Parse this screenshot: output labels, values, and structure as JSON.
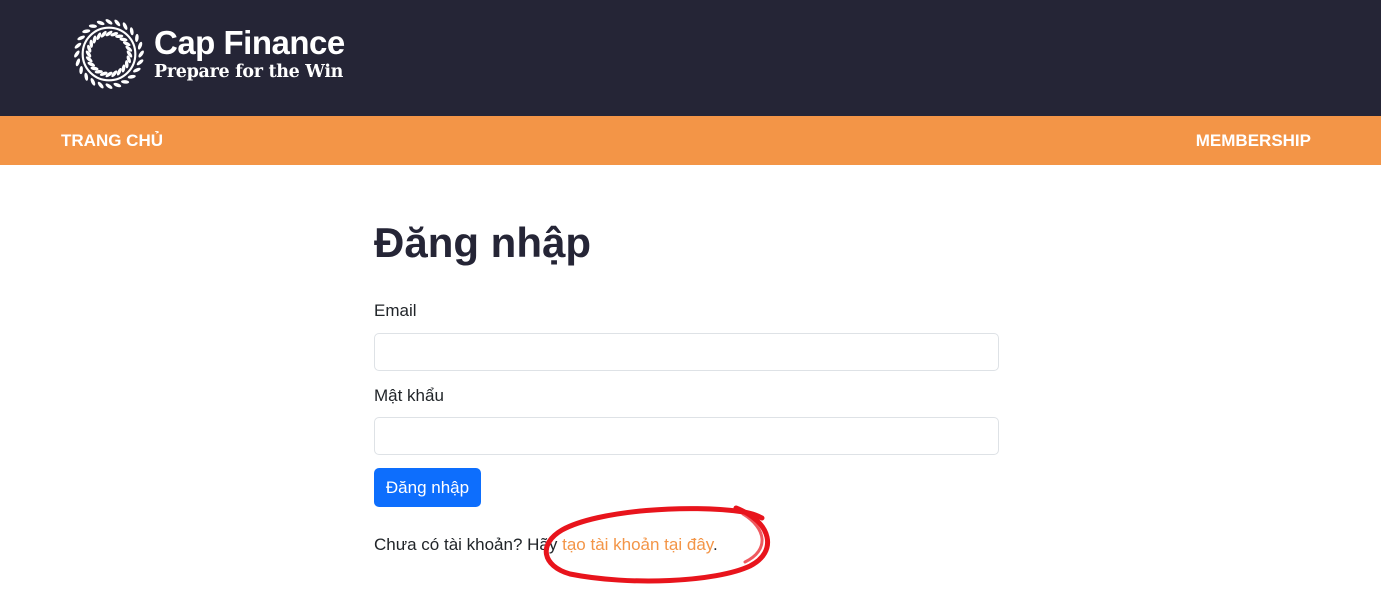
{
  "header": {
    "brand_name": "Cap Finance",
    "tagline": "Prepare for the Win",
    "logo_icon": "laurel-wreath-icon"
  },
  "nav": {
    "home": "TRANG CHỦ",
    "membership": "MEMBERSHIP"
  },
  "form": {
    "title": "Đăng nhập",
    "email_label": "Email",
    "email_value": "",
    "password_label": "Mật khẩu",
    "password_value": "",
    "submit_label": "Đăng nhập",
    "signup_prefix": "Chưa có tài khoản? Hãy ",
    "signup_link": "tạo tài khoản tại đây",
    "signup_suffix": "."
  },
  "colors": {
    "header_bg": "#252536",
    "nav_bg": "#f39547",
    "primary_button": "#0d6efd",
    "link": "#f39547",
    "annotation": "#e8141c"
  }
}
